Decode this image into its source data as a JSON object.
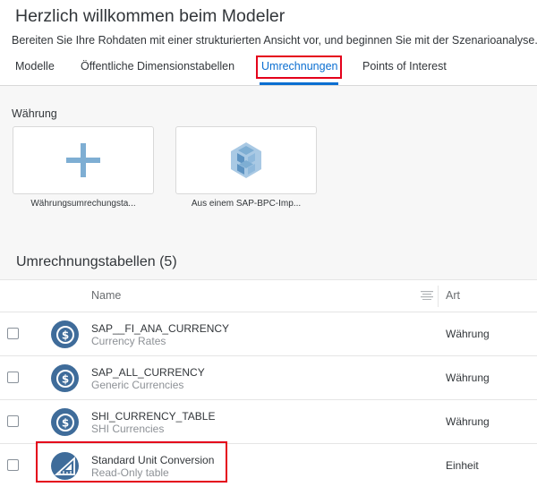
{
  "header": {
    "title": "Herzlich willkommen beim Modeler",
    "subtitle": "Bereiten Sie Ihre Rohdaten mit einer strukturierten Ansicht vor, und beginnen Sie mit der Szenarioanalyse."
  },
  "tabs": [
    {
      "label": "Modelle"
    },
    {
      "label": "Öffentliche Dimensionstabellen"
    },
    {
      "label": "Umrechnungen",
      "active": true
    },
    {
      "label": "Points of Interest"
    }
  ],
  "currency_section": {
    "label": "Währung",
    "tiles": [
      {
        "caption": "Währungsumrechungsta...",
        "icon": "plus-icon"
      },
      {
        "caption": "Aus einem SAP-BPC-Imp...",
        "icon": "cube-icon"
      }
    ]
  },
  "table": {
    "title": "Umrechnungstabellen (5)",
    "columns": {
      "name": "Name",
      "type": "Art"
    },
    "rows": [
      {
        "name": "SAP__FI_ANA_CURRENCY",
        "description": "Currency Rates",
        "type": "Währung",
        "icon": "currency-icon"
      },
      {
        "name": "SAP_ALL_CURRENCY",
        "description": "Generic Currencies",
        "type": "Währung",
        "icon": "currency-icon"
      },
      {
        "name": "SHI_CURRENCY_TABLE",
        "description": "SHI Currencies",
        "type": "Währung",
        "icon": "currency-icon"
      },
      {
        "name": "Standard Unit Conversion",
        "description": "Read-Only table",
        "type": "Einheit",
        "icon": "unit-conversion-icon"
      }
    ]
  },
  "colors": {
    "accent": "#0a6ed1",
    "highlight": "#e4001b",
    "icon_bg": "#3f6c9a",
    "tile_icon": "#7eaed3"
  }
}
